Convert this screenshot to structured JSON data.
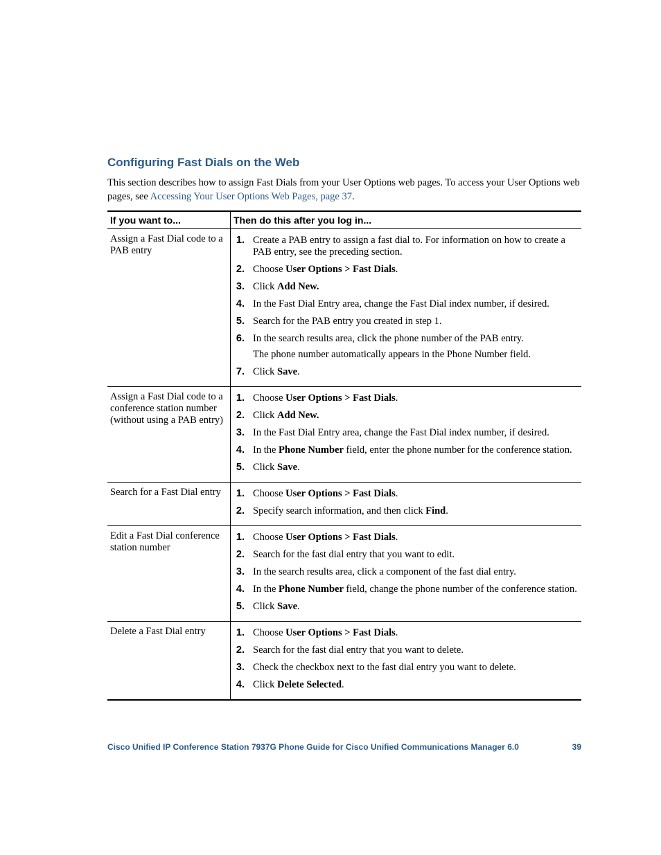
{
  "heading": "Configuring Fast Dials on the Web",
  "intro_part1": "This section describes how to assign Fast Dials from your User Options web pages. To access your User Options web pages, see ",
  "intro_link": "Accessing Your User Options Web Pages, page 37",
  "intro_part2": ".",
  "table": {
    "header_left": "If you want to...",
    "header_right": "Then do this after you log in...",
    "rows": [
      {
        "want": "Assign a Fast Dial code to a PAB entry",
        "steps": [
          {
            "html": "Create a PAB entry to assign a fast dial to. For information on how to create a PAB entry, see the preceding section."
          },
          {
            "html": "Choose <span class='bold'>User Options &gt; Fast Dials</span>."
          },
          {
            "html": "Click <span class='bold'>Add New.</span>"
          },
          {
            "html": "In the Fast Dial Entry area, change the Fast Dial index number, if desired."
          },
          {
            "html": "Search for the PAB entry you created in step 1."
          },
          {
            "html": "In the search results area, click the phone number of the PAB entry.",
            "sub": "The phone number automatically appears in the Phone Number field."
          },
          {
            "html": "Click <span class='bold'>Save</span>."
          }
        ]
      },
      {
        "want": "Assign a Fast Dial code to a conference station number (without using a PAB entry)",
        "steps": [
          {
            "html": "Choose <span class='bold'>User Options &gt; Fast Dials</span>."
          },
          {
            "html": "Click <span class='bold'>Add New.</span>"
          },
          {
            "html": "In the Fast Dial Entry area, change the Fast Dial index number, if desired."
          },
          {
            "html": "In the <span class='bold'>Phone Number</span> field, enter the phone number for the conference station."
          },
          {
            "html": "Click <span class='bold'>Save</span>."
          }
        ]
      },
      {
        "want": "Search for a Fast Dial entry",
        "steps": [
          {
            "html": "Choose <span class='bold'>User Options &gt; Fast Dials</span>."
          },
          {
            "html": "Specify search information, and then click <span class='bold'>Find</span>."
          }
        ]
      },
      {
        "want": "Edit a Fast Dial conference station number",
        "steps": [
          {
            "html": "Choose <span class='bold'>User Options &gt; Fast Dials</span>."
          },
          {
            "html": "Search for the fast dial entry that you want to edit."
          },
          {
            "html": "In the search results area, click a component of the fast dial entry."
          },
          {
            "html": "In the <span class='bold'>Phone Number</span> field, change the phone number of the conference station."
          },
          {
            "html": "Click <span class='bold'>Save</span>."
          }
        ]
      },
      {
        "want": "Delete a Fast Dial entry",
        "steps": [
          {
            "html": "Choose <span class='bold'>User Options &gt; Fast Dials</span>."
          },
          {
            "html": "Search for the fast dial entry that you want to delete."
          },
          {
            "html": "Check the checkbox next to the fast dial entry you want to delete."
          },
          {
            "html": "Click <span class='bold'>Delete Selected</span>."
          }
        ]
      }
    ]
  },
  "footer_title": "Cisco Unified IP Conference Station 7937G Phone Guide for Cisco Unified Communications Manager 6.0",
  "footer_page": "39"
}
